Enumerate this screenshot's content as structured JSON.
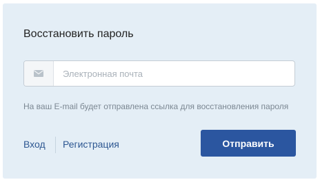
{
  "form": {
    "title": "Восстановить пароль",
    "email_placeholder": "Электронная почта",
    "email_value": "",
    "email_icon": "envelope-icon",
    "hint": "На ваш E-mail будет отправлена ссылка для восстановления пароля",
    "submit_label": "Отправить"
  },
  "links": {
    "login": "Вход",
    "register": "Регистрация"
  },
  "colors": {
    "panel_background": "#e4eef6",
    "primary_button": "#2b56a0",
    "link": "#2c5691",
    "hint_text": "#7b8792"
  }
}
